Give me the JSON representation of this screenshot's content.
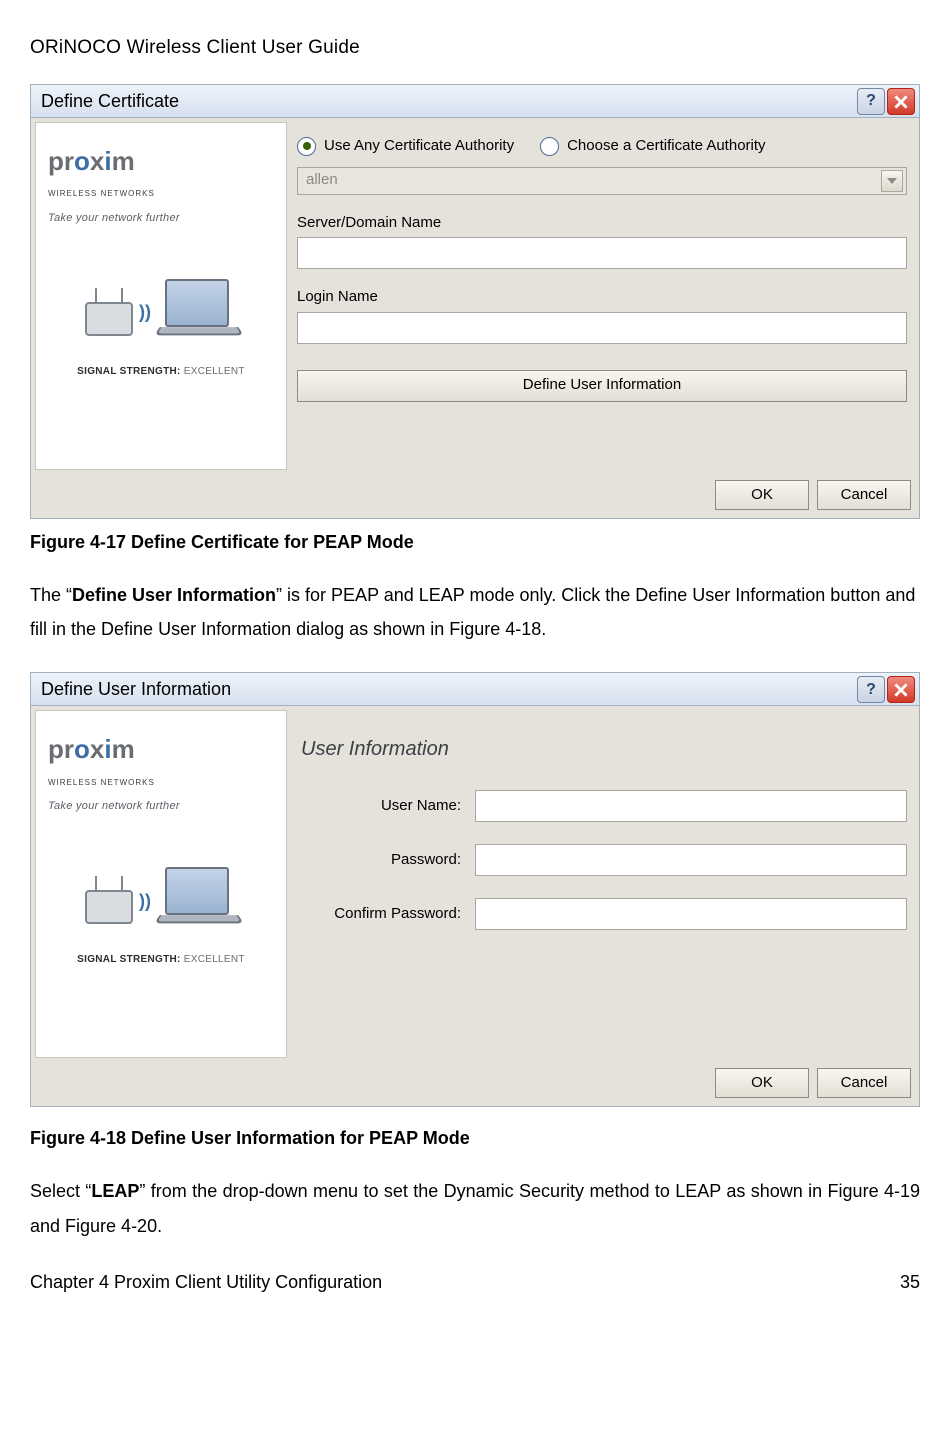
{
  "header": {
    "title": "ORiNOCO Wireless Client User Guide"
  },
  "sidebar": {
    "brand_sub": "WIRELESS NETWORKS",
    "tagline": "Take your network further",
    "signal_label": "SIGNAL STRENGTH:",
    "signal_value": "EXCELLENT"
  },
  "dialog1": {
    "title": "Define Certificate",
    "radio1": "Use Any Certificate Authority",
    "radio2": "Choose a Certificate Authority",
    "dropdown_value": "allen",
    "server_domain_label": "Server/Domain Name",
    "login_name_label": "Login Name",
    "define_user_btn": "Define User Information",
    "ok": "OK",
    "cancel": "Cancel"
  },
  "caption1": "Figure 4-17 Define Certificate for PEAP Mode",
  "para1_a": "The “",
  "para1_bold": "Define User Information",
  "para1_b": "” is for PEAP and LEAP mode only. Click the Define User Information button and fill in the Define User Information dialog as shown in Figure 4-18.",
  "dialog2": {
    "title": "Define User Information",
    "header": "User Information",
    "username_label": "User Name:",
    "password_label": "Password:",
    "confirm_label": "Confirm Password:",
    "ok": "OK",
    "cancel": "Cancel"
  },
  "caption2": "Figure 4-18  Define User Information for PEAP Mode",
  "para2_a": "Select “",
  "para2_bold": "LEAP",
  "para2_b": "” from the drop-down menu to set the Dynamic Security method to LEAP as shown in Figure 4-19 and Figure 4-20.",
  "footer": {
    "chapter": "Chapter 4 Proxim Client Utility Configuration",
    "page": "35"
  }
}
